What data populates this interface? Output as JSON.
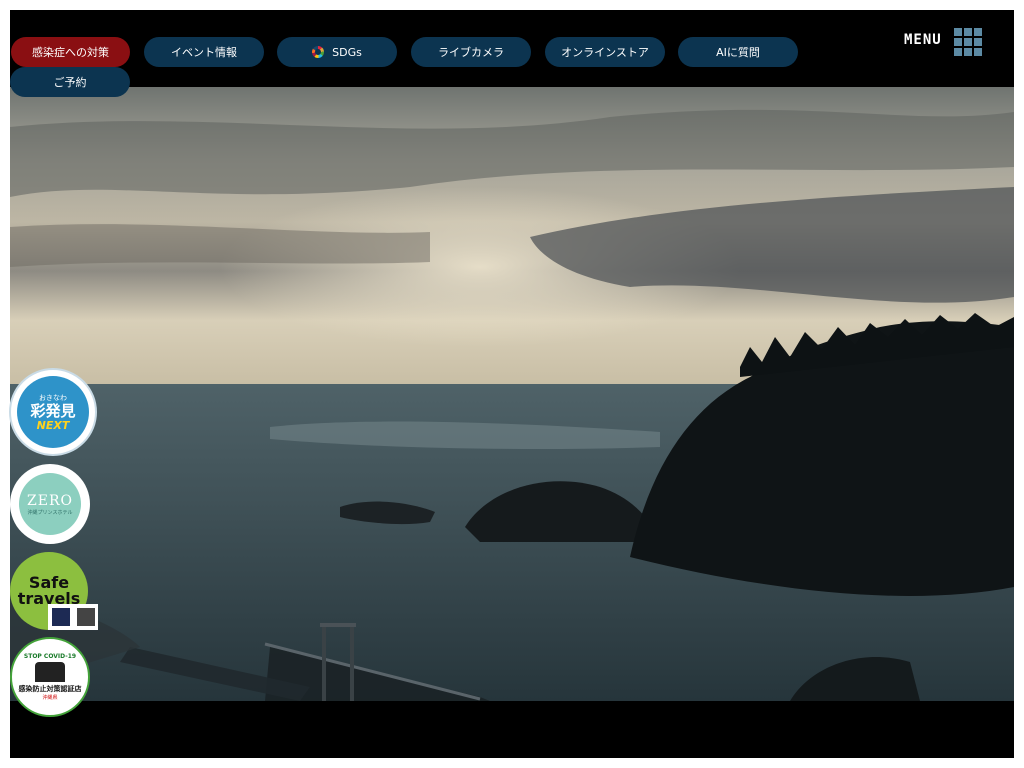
{
  "nav": {
    "items": [
      {
        "label": "感染症への対策",
        "accent": "#8a0f12"
      },
      {
        "label": "イベント情報"
      },
      {
        "label": "SDGs",
        "icon": "sdgs-wheel-icon"
      },
      {
        "label": "ライブカメラ"
      },
      {
        "label": "オンラインストア"
      },
      {
        "label": "AIに質問"
      },
      {
        "label": "ご予約"
      }
    ],
    "menu_label": "MENU",
    "menu_icon": "grid-menu-icon"
  },
  "badges": {
    "ayahakken": {
      "line1": "おきなわ",
      "line2": "彩発見",
      "line3": "NEXT"
    },
    "zero": {
      "title": "ZERO",
      "subtitle": "沖縄プリンスホテル"
    },
    "safe_travels": {
      "line1": "Safe",
      "line2": "travels"
    },
    "covid": {
      "top": "STOP COVID-19",
      "bottom": "感染防止対策認証店",
      "pref": "沖縄県"
    }
  },
  "colors": {
    "nav_pill": "#0c3450",
    "nav_pill_accent": "#8a0f12",
    "menu_grid": "#5c8aa4"
  }
}
